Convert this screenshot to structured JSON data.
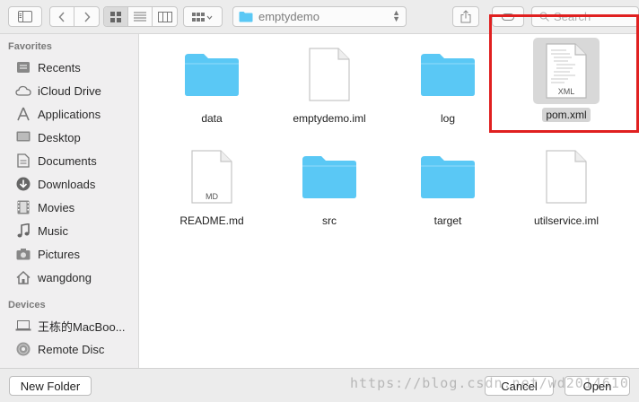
{
  "toolbar": {
    "path_label": "emptydemo",
    "search_placeholder": "Search",
    "icons": [
      "sidebar-toggle-icon",
      "back-icon",
      "forward-icon",
      "icon-view-icon",
      "list-view-icon",
      "column-view-icon",
      "arrange-icon",
      "folder-icon",
      "share-icon",
      "tag-icon"
    ]
  },
  "sidebar": {
    "favorites_header": "Favorites",
    "favorites": [
      {
        "label": "Recents",
        "icon": "recents-icon"
      },
      {
        "label": "iCloud Drive",
        "icon": "cloud-icon"
      },
      {
        "label": "Applications",
        "icon": "applications-icon"
      },
      {
        "label": "Desktop",
        "icon": "desktop-icon"
      },
      {
        "label": "Documents",
        "icon": "documents-icon"
      },
      {
        "label": "Downloads",
        "icon": "downloads-icon"
      },
      {
        "label": "Movies",
        "icon": "movies-icon"
      },
      {
        "label": "Music",
        "icon": "music-icon"
      },
      {
        "label": "Pictures",
        "icon": "camera-icon"
      },
      {
        "label": "wangdong",
        "icon": "home-icon"
      }
    ],
    "devices_header": "Devices",
    "devices": [
      {
        "label": "王栋的MacBoo...",
        "icon": "laptop-icon"
      },
      {
        "label": "Remote Disc",
        "icon": "disc-icon"
      }
    ]
  },
  "files": [
    {
      "name": "data",
      "kind": "folder"
    },
    {
      "name": "emptydemo.iml",
      "kind": "document"
    },
    {
      "name": "log",
      "kind": "folder"
    },
    {
      "name": "pom.xml",
      "kind": "xml",
      "badge": "XML",
      "selected": true
    },
    {
      "name": "README.md",
      "kind": "markdown",
      "badge": "MD"
    },
    {
      "name": "src",
      "kind": "folder"
    },
    {
      "name": "target",
      "kind": "folder"
    },
    {
      "name": "utilservice.iml",
      "kind": "document"
    }
  ],
  "bottom": {
    "new_folder": "New Folder",
    "cancel": "Cancel",
    "open": "Open"
  },
  "watermark": "https://blog.csdn.net/wd2014610",
  "colors": {
    "highlight": "#e02020",
    "folder": "#5ac8f5",
    "selection": "#d8d8d8"
  }
}
